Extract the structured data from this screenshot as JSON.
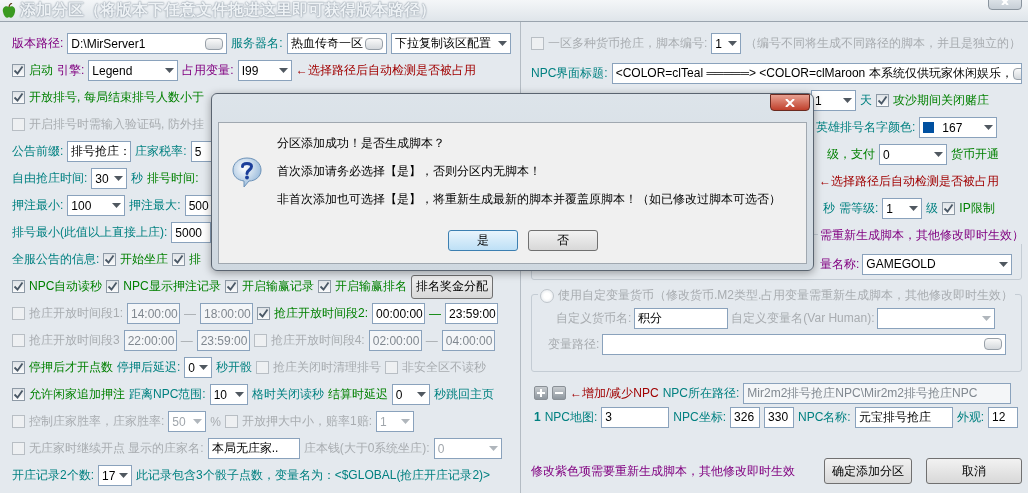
{
  "window": {
    "title": "添加分区（将版本下任意文件拖进这里即可获得版本路径）"
  },
  "left_rows": [
    {
      "items": [
        {
          "kind": "label",
          "text": "版本路径:"
        },
        {
          "kind": "field",
          "value": "D:\\MirServer1",
          "browse": true
        },
        {
          "kind": "label",
          "text": "服务器名:"
        },
        {
          "kind": "field",
          "value": "热血传奇一区",
          "browse": true
        },
        {
          "kind": "combo",
          "value": "下拉复制该区配置"
        }
      ]
    },
    {
      "items": [
        {
          "kind": "check",
          "label": "启动",
          "checked": true
        },
        {
          "kind": "label",
          "text": "引擎:"
        },
        {
          "kind": "combo",
          "value": "Legend"
        },
        {
          "kind": "label",
          "text": "占用变量:"
        },
        {
          "kind": "combo",
          "value": "I99"
        },
        {
          "kind": "label",
          "text": "←选择路径后自动检测是否被占用"
        }
      ]
    },
    {
      "items": [
        {
          "kind": "check",
          "label": "开放排号, 每局结束排号人数小于",
          "checked": true
        }
      ]
    },
    {
      "items": [
        {
          "kind": "check",
          "label": "开启排号时需输入验证码, 防外挂",
          "checked": false,
          "disabled": true
        }
      ]
    },
    {
      "items": [
        {
          "kind": "label",
          "text": "公告前缀:"
        },
        {
          "kind": "field",
          "value": "排号抢庄："
        },
        {
          "kind": "label",
          "text": "庄家税率:"
        },
        {
          "kind": "field",
          "value": "5"
        }
      ]
    },
    {
      "items": [
        {
          "kind": "label",
          "text": "自由抢庄时间:"
        },
        {
          "kind": "combo",
          "value": "30"
        },
        {
          "kind": "label",
          "text": "秒"
        },
        {
          "kind": "label",
          "text": "排号时间:"
        }
      ]
    },
    {
      "items": [
        {
          "kind": "label",
          "text": "押注最小:"
        },
        {
          "kind": "combo",
          "value": "100"
        },
        {
          "kind": "label",
          "text": "押注最大:"
        },
        {
          "kind": "field",
          "value": "500"
        }
      ]
    },
    {
      "items": [
        {
          "kind": "label",
          "text": "排号最小(此值以上直接上庄):"
        },
        {
          "kind": "field",
          "value": "5000"
        }
      ]
    },
    {
      "items": [
        {
          "kind": "label",
          "text": "全服公告的信息:"
        },
        {
          "kind": "check",
          "label": "开始坐庄",
          "checked": true
        },
        {
          "kind": "check",
          "label": "排",
          "checked": true
        }
      ]
    },
    {
      "items": [
        {
          "kind": "check",
          "label": "NPC自动读秒",
          "checked": true
        },
        {
          "kind": "check",
          "label": "NPC显示押注记录",
          "checked": true
        },
        {
          "kind": "check",
          "label": "开启输赢记录",
          "checked": true
        },
        {
          "kind": "check",
          "label": "开启输赢排名",
          "checked": true
        },
        {
          "kind": "button",
          "label": "排名奖金分配"
        }
      ]
    },
    {
      "items": [
        {
          "kind": "check",
          "label": "抢庄开放时间段1:",
          "checked": false,
          "disabled": true
        },
        {
          "kind": "field",
          "value": "14:00:00",
          "disabled": true
        },
        {
          "kind": "dash",
          "text": "—",
          "disabled": true
        },
        {
          "kind": "field",
          "value": "18:00:00",
          "disabled": true
        },
        {
          "kind": "check",
          "label": "抢庄开放时间段2:",
          "checked": true
        },
        {
          "kind": "field",
          "value": "00:00:00"
        },
        {
          "kind": "dash",
          "text": "—"
        },
        {
          "kind": "field",
          "value": "23:59:00"
        }
      ]
    },
    {
      "items": [
        {
          "kind": "check",
          "label": "抢庄开放时间段3",
          "checked": false,
          "disabled": true
        },
        {
          "kind": "field",
          "value": "22:00:00",
          "disabled": true
        },
        {
          "kind": "dash",
          "text": "—",
          "disabled": true
        },
        {
          "kind": "field",
          "value": "23:59:00",
          "disabled": true
        },
        {
          "kind": "check",
          "label": "抢庄开放时间段4:",
          "checked": false,
          "disabled": true
        },
        {
          "kind": "field",
          "value": "02:00:00",
          "disabled": true
        },
        {
          "kind": "dash",
          "text": "—",
          "disabled": true
        },
        {
          "kind": "field",
          "value": "04:00:00",
          "disabled": true
        }
      ]
    },
    {
      "items": [
        {
          "kind": "check",
          "label": "停押后才开点数",
          "checked": true
        },
        {
          "kind": "label",
          "text": "停押后延迟:"
        },
        {
          "kind": "combo",
          "value": "0"
        },
        {
          "kind": "label",
          "text": "秒开骰"
        },
        {
          "kind": "check",
          "label": "抢庄关闭时清理排号",
          "checked": false,
          "disabled": true
        },
        {
          "kind": "check",
          "label": "非安全区不读秒",
          "checked": false,
          "disabled": true
        }
      ]
    },
    {
      "items": [
        {
          "kind": "check",
          "label": "允许闲家追加押注",
          "checked": true
        },
        {
          "kind": "label",
          "text": "距离NPC范围:"
        },
        {
          "kind": "combo",
          "value": "10"
        },
        {
          "kind": "label",
          "text": "格时关闭读秒"
        },
        {
          "kind": "label",
          "text": "结算时延迟"
        },
        {
          "kind": "combo",
          "value": "0"
        },
        {
          "kind": "label",
          "text": "秒跳回主页"
        }
      ]
    },
    {
      "items": [
        {
          "kind": "check",
          "label": "控制庄家胜率，庄家胜率:",
          "checked": false,
          "disabled": true
        },
        {
          "kind": "combo",
          "value": "50",
          "disabled": true
        },
        {
          "kind": "label",
          "text": "%",
          "disabled": true
        },
        {
          "kind": "check",
          "label": "开放押大中小，赔率1赔:",
          "checked": false,
          "disabled": true
        },
        {
          "kind": "combo",
          "value": "1",
          "disabled": true
        }
      ]
    },
    {
      "items": [
        {
          "kind": "check",
          "label": "无庄家时继续开点 显示的庄家名:",
          "checked": false,
          "disabled": true
        },
        {
          "kind": "field",
          "value": "本局无庄家.."
        },
        {
          "kind": "label",
          "text": "庄本钱(大于0系统坐庄):",
          "disabled": true
        },
        {
          "kind": "combo",
          "value": "0",
          "disabled": true
        }
      ]
    },
    {
      "items": [
        {
          "kind": "label",
          "text": "开庄记录2个数:"
        },
        {
          "kind": "combo",
          "value": "17"
        },
        {
          "kind": "label",
          "text": "此记录包含3个骰子点数，变量名为：<$GLOBAL(抢庄开庄记录2)>"
        }
      ]
    }
  ],
  "right_rows": [
    {
      "items": [
        {
          "kind": "check",
          "label": "一区多种货币抢庄，脚本编号:",
          "checked": false,
          "disabled": true
        },
        {
          "kind": "combo",
          "value": "1"
        },
        {
          "kind": "label",
          "text": "（编号不同将生成不同路径的脚本，并且是独立的）",
          "disabled": true
        }
      ]
    },
    {
      "items": [
        {
          "kind": "label",
          "text": "NPC界面标题:"
        },
        {
          "kind": "field",
          "value": "<COLOR=clTeal ═════> <COLOR=clMaroon 本系统仅供玩家休闲娱乐，",
          "browse": true
        }
      ]
    },
    {
      "items": [
        {
          "kind": "combo",
          "value": "1"
        },
        {
          "kind": "label",
          "text": "天"
        },
        {
          "kind": "check",
          "label": "攻沙期间关闭赌庄",
          "checked": true
        }
      ]
    },
    {
      "items": [
        {
          "kind": "label",
          "text": "英雄排号名字颜色:"
        },
        {
          "kind": "swatch_combo",
          "value": "167",
          "color": "#0050a0"
        }
      ]
    },
    {
      "items": [
        {
          "kind": "label",
          "text": "级，支付"
        },
        {
          "kind": "combo",
          "value": "0"
        },
        {
          "kind": "label",
          "text": "货币开通"
        }
      ]
    },
    {
      "items": [
        {
          "kind": "label",
          "text": "←选择路径后自动检测是否被占用"
        }
      ]
    },
    {
      "items": [
        {
          "kind": "label",
          "text": "秒"
        },
        {
          "kind": "label",
          "text": "需等级:"
        },
        {
          "kind": "combo",
          "value": "1"
        },
        {
          "kind": "label",
          "text": "级"
        },
        {
          "kind": "check",
          "label": "IP限制",
          "checked": true
        }
      ]
    }
  ],
  "currency_group": {
    "caption": "需重新生成脚本，其他修改即时生效）",
    "items": [
      {
        "kind": "label",
        "text": "量名称:"
      },
      {
        "kind": "combo",
        "value": "GAMEGOLD"
      }
    ]
  },
  "custom_group": {
    "caption": "使用自定变量货币（修改货币.M2类型.占用变量需重新生成脚本，其他修改即时生效）",
    "selected": false,
    "disabled": true,
    "rows": [
      {
        "items": [
          {
            "kind": "label",
            "text": "自定义货币名:",
            "disabled": true
          },
          {
            "kind": "field",
            "value": "积分"
          },
          {
            "kind": "label",
            "text": "自定义变量名(Var Human):",
            "disabled": true
          },
          {
            "kind": "combo",
            "value": "",
            "disabled": true
          }
        ]
      },
      {
        "items": [
          {
            "kind": "label",
            "text": "变量路径:",
            "disabled": true
          },
          {
            "kind": "field",
            "value": "",
            "browse": true
          }
        ]
      }
    ]
  },
  "npc_rows": [
    {
      "items": [
        {
          "kind": "plus"
        },
        {
          "kind": "minus"
        },
        {
          "kind": "label",
          "text": "←增加/减少NPC"
        },
        {
          "kind": "label",
          "text": "NPC所在路径:"
        },
        {
          "kind": "field",
          "value": "Mir2m2排号抢庄NPC\\Mir2m2排号抢庄NPC",
          "disabled": true
        }
      ]
    },
    {
      "items": [
        {
          "kind": "label",
          "text": "1",
          "bold": true
        },
        {
          "kind": "label",
          "text": "NPC地图:"
        },
        {
          "kind": "field",
          "value": "3"
        },
        {
          "kind": "label",
          "text": "NPC坐标:"
        },
        {
          "kind": "field",
          "value": "326"
        },
        {
          "kind": "field",
          "value": "330"
        },
        {
          "kind": "label",
          "text": "NPC名称:"
        },
        {
          "kind": "field",
          "value": "元宝排号抢庄"
        },
        {
          "kind": "label",
          "text": "外观:"
        },
        {
          "kind": "field",
          "value": "12"
        }
      ]
    }
  ],
  "footer": {
    "note": "修改紫色项需要重新生成脚本，其他修改即时生效",
    "buttons": [
      {
        "label": "确定添加分区"
      },
      {
        "label": "取消"
      }
    ]
  },
  "dialog": {
    "lines": [
      "分区添加成功！是否生成脚本？",
      "首次添加请务必选择【是】，否则分区内无脚本！",
      "非首次添加也可选择【是】，将重新生成最新的脚本并覆盖原脚本！（如已修改过脚本可选否）"
    ],
    "buttons": [
      {
        "label": "是",
        "selected": true
      },
      {
        "label": "否",
        "selected": false
      }
    ]
  }
}
